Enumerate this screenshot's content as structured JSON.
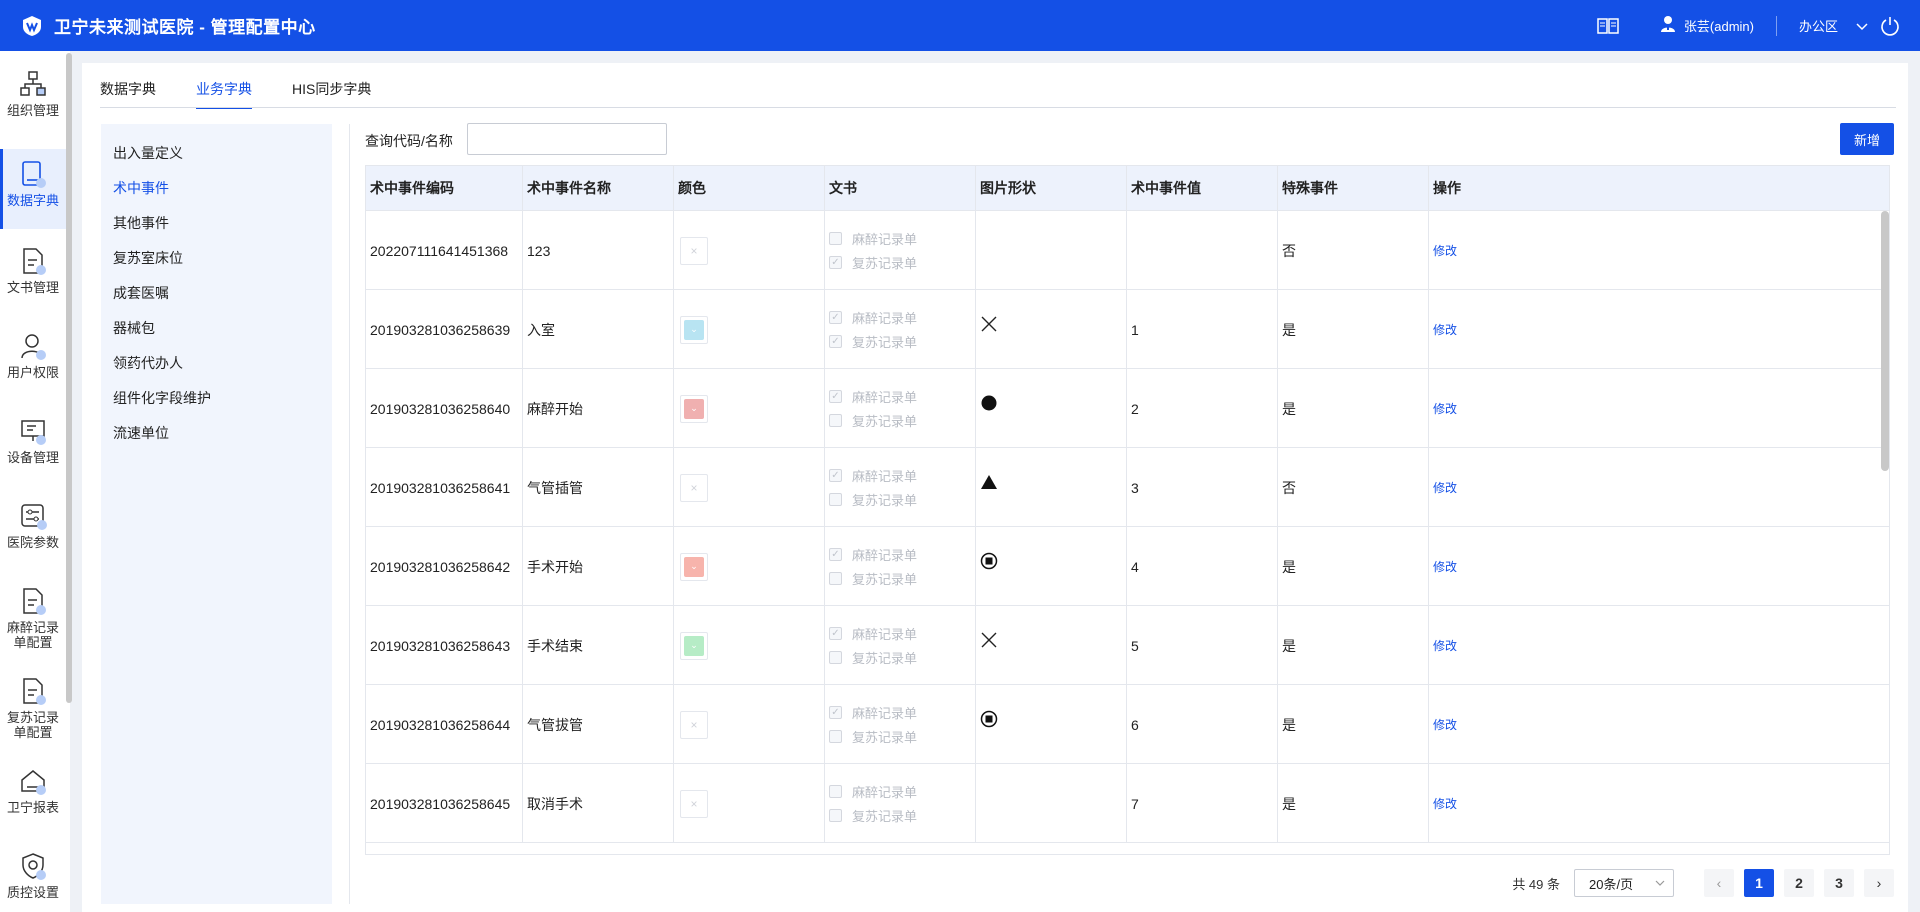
{
  "header": {
    "title": "卫宁未来测试医院 - 管理配置中心",
    "user_name": "张芸(admin)",
    "office": "办公区"
  },
  "nav": {
    "items": [
      {
        "label": "组织管理",
        "icon": "org-chart-icon"
      },
      {
        "label": "数据字典",
        "icon": "book-icon"
      },
      {
        "label": "文书管理",
        "icon": "document-icon"
      },
      {
        "label": "用户权限",
        "icon": "user-icon"
      },
      {
        "label": "设备管理",
        "icon": "monitor-icon"
      },
      {
        "label": "医院参数",
        "icon": "sliders-icon"
      },
      {
        "label": "麻醉记录单配置",
        "icon": "document-icon"
      },
      {
        "label": "复苏记录单配置",
        "icon": "document-icon"
      },
      {
        "label": "卫宁报表",
        "icon": "chart-house-icon"
      },
      {
        "label": "质控设置",
        "icon": "shield-icon"
      }
    ],
    "active_index": 1
  },
  "tabs": [
    {
      "label": "数据字典"
    },
    {
      "label": "业务字典"
    },
    {
      "label": "HIS同步字典"
    }
  ],
  "side_list": [
    "出入量定义",
    "术中事件",
    "其他事件",
    "复苏室床位",
    "成套医嘱",
    "器械包",
    "领药代办人",
    "组件化字段维护",
    "流速单位"
  ],
  "search": {
    "label": "查询代码/名称",
    "value": "",
    "placeholder": ""
  },
  "add_button": "新增",
  "table": {
    "columns": [
      "术中事件编码",
      "术中事件名称",
      "颜色",
      "文书",
      "图片形状",
      "术中事件值",
      "特殊事件",
      "操作"
    ],
    "doc_labels": [
      "麻醉记录单",
      "复苏记录单"
    ],
    "rows": [
      {
        "code": "202207111641451368",
        "name": "123",
        "color": "",
        "docs": [
          false,
          true
        ],
        "shape": "",
        "value": "",
        "special": "否",
        "action": "修改"
      },
      {
        "code": "201903281036258639",
        "name": "入室",
        "color": "#b8e4f2",
        "docs": [
          true,
          true
        ],
        "shape": "cross",
        "value": "1",
        "special": "是",
        "action": "修改"
      },
      {
        "code": "201903281036258640",
        "name": "麻醉开始",
        "color": "#f0b0b0",
        "docs": [
          true,
          false
        ],
        "shape": "circle",
        "value": "2",
        "special": "是",
        "action": "修改"
      },
      {
        "code": "201903281036258641",
        "name": "气管插管",
        "color": "",
        "docs": [
          true,
          false
        ],
        "shape": "triangle",
        "value": "3",
        "special": "否",
        "action": "修改"
      },
      {
        "code": "201903281036258642",
        "name": "手术开始",
        "color": "#f7b4ac",
        "docs": [
          true,
          false
        ],
        "shape": "target",
        "value": "4",
        "special": "是",
        "action": "修改"
      },
      {
        "code": "201903281036258643",
        "name": "手术结束",
        "color": "#b6ecc6",
        "docs": [
          true,
          false
        ],
        "shape": "cross",
        "value": "5",
        "special": "是",
        "action": "修改"
      },
      {
        "code": "201903281036258644",
        "name": "气管拔管",
        "color": "",
        "docs": [
          true,
          false
        ],
        "shape": "target",
        "value": "6",
        "special": "是",
        "action": "修改"
      },
      {
        "code": "201903281036258645",
        "name": "取消手术",
        "color": "",
        "docs": [
          false,
          false
        ],
        "shape": "",
        "value": "7",
        "special": "是",
        "action": "修改"
      }
    ]
  },
  "pagination": {
    "total": "共 49 条",
    "page_size": "20条/页",
    "pages": [
      "1",
      "2",
      "3"
    ],
    "current": "1"
  },
  "colors": {
    "primary": "#1450e6",
    "header_bg": "#edf2fc",
    "side_bg": "#f1f5fd"
  }
}
